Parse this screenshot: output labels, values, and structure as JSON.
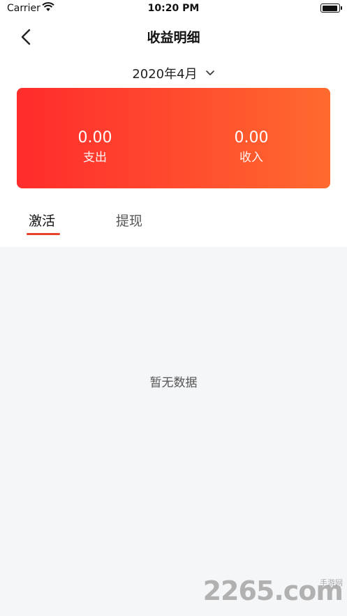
{
  "status_bar": {
    "carrier": "Carrier",
    "time": "10:20 PM"
  },
  "nav": {
    "title": "收益明细"
  },
  "month_selector": {
    "label": "2020年4月"
  },
  "summary": {
    "expense": {
      "value": "0.00",
      "label": "支出"
    },
    "income": {
      "value": "0.00",
      "label": "收入"
    }
  },
  "tabs": [
    {
      "label": "激活",
      "active": true
    },
    {
      "label": "提现",
      "active": false
    }
  ],
  "content": {
    "empty_message": "暂无数据"
  },
  "watermark": {
    "text": "2265.com",
    "small_text": "手游网"
  },
  "colors": {
    "card_start": "#ff2c2c",
    "card_end": "#ff6a2e",
    "accent": "#e8432c",
    "content_bg": "#f5f6f8"
  }
}
